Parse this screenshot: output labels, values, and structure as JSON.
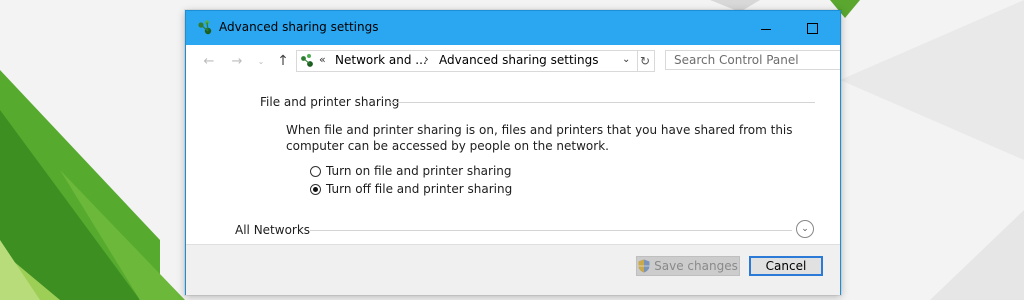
{
  "window": {
    "title": "Advanced sharing settings"
  },
  "navigation": {
    "breadcrumb_prefix": "«",
    "breadcrumb_parent": "Network and ...",
    "breadcrumb_separator": "›",
    "breadcrumb_current": "Advanced sharing settings"
  },
  "search": {
    "placeholder": "Search Control Panel"
  },
  "file_printer_section": {
    "heading": "File and printer sharing",
    "description": "When file and printer sharing is on, files and printers that you have shared from this computer can be accessed by people on the network.",
    "options": [
      {
        "label": "Turn on file and printer sharing",
        "selected": false
      },
      {
        "label": "Turn off file and printer sharing",
        "selected": true
      }
    ]
  },
  "all_networks_section": {
    "heading": "All Networks"
  },
  "footer": {
    "save_label": "Save changes",
    "cancel_label": "Cancel"
  },
  "colors": {
    "titlebar": "#2ba6f0",
    "window_border": "#1a8fd8",
    "default_button_border": "#2b7ad8",
    "background_green_dark": "#4a9e2a",
    "background_green_light": "#8cc63e"
  },
  "icons": {
    "app": "network-icon",
    "back": "back-arrow-icon",
    "forward": "forward-arrow-icon",
    "recent": "chevron-down-icon",
    "up": "up-arrow-icon",
    "refresh": "refresh-icon",
    "expand": "chevron-down-circle-icon",
    "save": "uac-shield-icon"
  }
}
